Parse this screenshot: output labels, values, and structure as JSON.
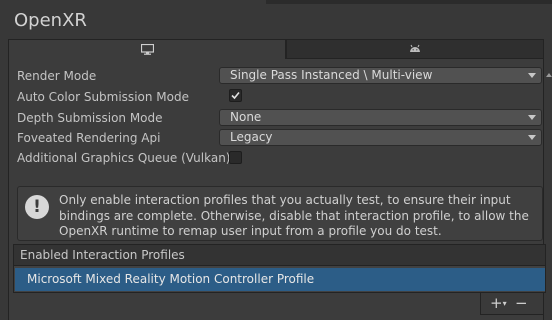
{
  "title": "OpenXR",
  "tabs": [
    {
      "name": "standalone",
      "icon": "monitor-icon",
      "active": true
    },
    {
      "name": "android",
      "icon": "android-icon",
      "active": false
    }
  ],
  "settings": {
    "render_mode": {
      "label": "Render Mode",
      "value": "Single Pass Instanced \\ Multi-view"
    },
    "auto_color": {
      "label": "Auto Color Submission Mode",
      "checked": true
    },
    "depth_submission": {
      "label": "Depth Submission Mode",
      "value": "None"
    },
    "foveated": {
      "label": "Foveated Rendering Api",
      "value": "Legacy"
    },
    "graphics_queue": {
      "label": "Additional Graphics Queue (Vulkan)",
      "checked": false
    }
  },
  "help_box": {
    "icon": "info-icon",
    "text": "Only enable interaction profiles that you actually test, to ensure their input bindings are complete. Otherwise, disable that interaction profile, to allow the OpenXR runtime to remap user input from a profile you do test."
  },
  "interaction_profiles": {
    "header": "Enabled Interaction Profiles",
    "items": [
      "Microsoft Mixed Reality Motion Controller Profile"
    ]
  },
  "footer": {
    "add_label": "+",
    "add_dropdown": "▾",
    "remove_label": "−"
  },
  "colors": {
    "selection": "#2c5d87",
    "background": "#383838",
    "panel": "#3c3c3c"
  }
}
